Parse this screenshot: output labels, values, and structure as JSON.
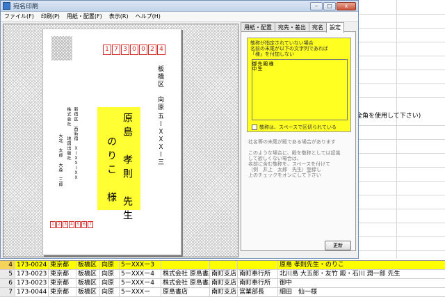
{
  "window": {
    "title": "宛名印刷",
    "controls": {
      "minimize": "–",
      "maximize": "□",
      "close": "x"
    }
  },
  "menu": [
    "ファイル(F)",
    "印刷(P)",
    "用紙・配置(F)",
    "表示(R)",
    "ヘルプ(H)"
  ],
  "postcard": {
    "zip": [
      "1",
      "7",
      "3",
      "0",
      "0",
      "2",
      "4"
    ],
    "address_line1": "板橋区　向原",
    "address_line2": "五ーＸＸＸー三",
    "recipient_name": "原島　孝則　先生",
    "recipient_name2": "のりこ　様",
    "sender_address": "新宿区　西新宿　ＸーＸＸーＸＸ",
    "sender_company": "株式会社　　地図出版社",
    "sender_name": "大北　太郎　大森　三郎",
    "sender_zip": [
      "1",
      "2",
      "3",
      "4",
      "5",
      "6",
      "7"
    ]
  },
  "tabs": [
    {
      "label": "用紙・配置"
    },
    {
      "label": "宛先・差出"
    },
    {
      "label": "宛名"
    },
    {
      "label": "設定"
    }
  ],
  "settings": {
    "help_text": "敬称が指定されていない場合\n名前の末尾が以下の文字列であれば\n「様」を付加しない",
    "textarea_lines": [
      "御中",
      "先生",
      "殿",
      "様"
    ],
    "checkbox_label": "敬称は、スペースで区切られている",
    "note1": "社名等の末尾が殿である場合があります",
    "note2": "このような場合に、殿を敬称としては認識\nして欲しくない場合は、\n名前に含む敬称を、スペースを付けて\n（例　井上　太郎　先生）登録し\n上のチェックをオンにして下さい",
    "update_button": "更新"
  },
  "background_text": "全角を使用して下さい)",
  "table": {
    "rows": [
      {
        "num": "4",
        "zip": "173-0024",
        "pref": "東京都",
        "city": "板橋区",
        "town": "向原",
        "block": "5ーXXXー3",
        "company": "",
        "branch": "",
        "dept": "",
        "name": "原島 孝則先生・のりこ",
        "selected": true
      },
      {
        "num": "5",
        "zip": "173-0023",
        "pref": "東京都",
        "city": "板橋区",
        "town": "向原",
        "block": "5ーXXXー4",
        "company": "株式会社 原島書店",
        "branch": "南町支店",
        "dept": "南町奉行所",
        "name": "北川島 大五郎・友竹 殿・石川 潤一郎 先生",
        "selected": false
      },
      {
        "num": "6",
        "zip": "173-0023",
        "pref": "東京都",
        "city": "板橋区",
        "town": "向原",
        "block": "5ーXXXー4",
        "company": "株式会社 原島書店",
        "branch": "南町支店",
        "dept": "南町奉行所",
        "name": "御中",
        "selected": false
      },
      {
        "num": "7",
        "zip": "173-0044",
        "pref": "東京都",
        "city": "板橋区",
        "town": "向原",
        "block": "5ーXXXー",
        "company": "原島書店",
        "branch": "南町支店",
        "dept": "営業部長",
        "name": "細田　仙一様",
        "selected": false
      }
    ]
  }
}
